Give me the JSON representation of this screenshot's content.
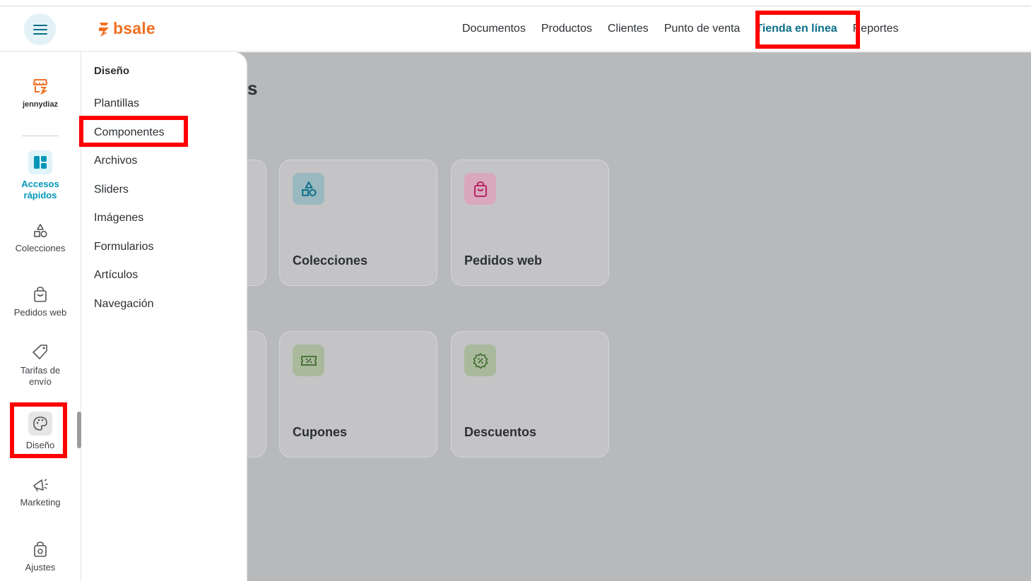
{
  "header": {
    "logo_text": "bsale",
    "nav": [
      {
        "label": "Documentos"
      },
      {
        "label": "Productos"
      },
      {
        "label": "Clientes"
      },
      {
        "label": "Punto de venta"
      },
      {
        "label": "Tienda en línea",
        "active": true
      },
      {
        "label": "Reportes"
      }
    ]
  },
  "sidebar": {
    "user": "jennydiaz",
    "items": [
      {
        "label": "Accesos rápidos",
        "icon": "dashboard-icon",
        "active": true
      },
      {
        "label": "Colecciones",
        "icon": "shapes-icon"
      },
      {
        "label": "Pedidos web",
        "icon": "shopping-bag-icon"
      },
      {
        "label": "Tarifas de envío",
        "icon": "tag-icon"
      },
      {
        "label": "Diseño",
        "icon": "palette-icon"
      },
      {
        "label": "Marketing",
        "icon": "megaphone-icon"
      },
      {
        "label": "Ajustes",
        "icon": "bag-settings-icon"
      }
    ]
  },
  "submenu": {
    "title": "Diseño",
    "items": [
      "Plantillas",
      "Componentes",
      "Archivos",
      "Sliders",
      "Imágenes",
      "Formularios",
      "Artículos",
      "Navegación"
    ]
  },
  "main": {
    "title_visible_fragment": "s",
    "cards": [
      {
        "label": "Colecciones",
        "icon": "shapes-icon",
        "color": "#0b6e88"
      },
      {
        "label": "Pedidos web",
        "icon": "shopping-bag-icon",
        "color": "#c2185b"
      },
      {
        "label": "Cupones",
        "icon": "coupon-icon",
        "color": "#3e6b2d"
      },
      {
        "label": "Descuentos",
        "icon": "discount-badge-icon",
        "color": "#3e6b2d"
      }
    ]
  },
  "colors": {
    "brand": "#f26f21",
    "accent": "#0096b7",
    "highlight": "#ff0000"
  }
}
